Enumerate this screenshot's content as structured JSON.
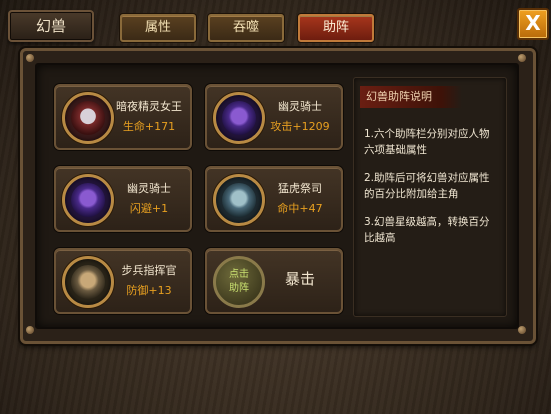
{
  "header": {
    "title": "幻兽",
    "tabs": [
      {
        "label": "属性",
        "active": false
      },
      {
        "label": "吞噬",
        "active": false
      },
      {
        "label": "助阵",
        "active": true
      }
    ],
    "close_label": "X"
  },
  "slots": [
    {
      "name": "暗夜精灵女王",
      "stat": "生命+171",
      "icon": "dark-elf-queen-portrait"
    },
    {
      "name": "幽灵骑士",
      "stat": "攻击+1209",
      "icon": "ghost-knight-portrait"
    },
    {
      "name": "幽灵骑士",
      "stat": "闪避+1",
      "icon": "ghost-knight-portrait"
    },
    {
      "name": "猛虎祭司",
      "stat": "命中+47",
      "icon": "tiger-priest-portrait"
    },
    {
      "name": "步兵指挥官",
      "stat": "防御+13",
      "icon": "infantry-commander-portrait"
    },
    {
      "locked_line1": "点击",
      "locked_line2": "助阵",
      "label": "暴击"
    }
  ],
  "description": {
    "title": "幻兽助阵说明",
    "items": [
      "1.六个助阵栏分别对应人物六项基础属性",
      "2.助阵后可将幻兽对应属性的百分比附加给主角",
      "3.幻兽星级越高，转换百分比越高"
    ]
  },
  "colors": {
    "stat": "#e8a020",
    "active_tab": "#a8361c",
    "close_button": "#f0a020"
  }
}
